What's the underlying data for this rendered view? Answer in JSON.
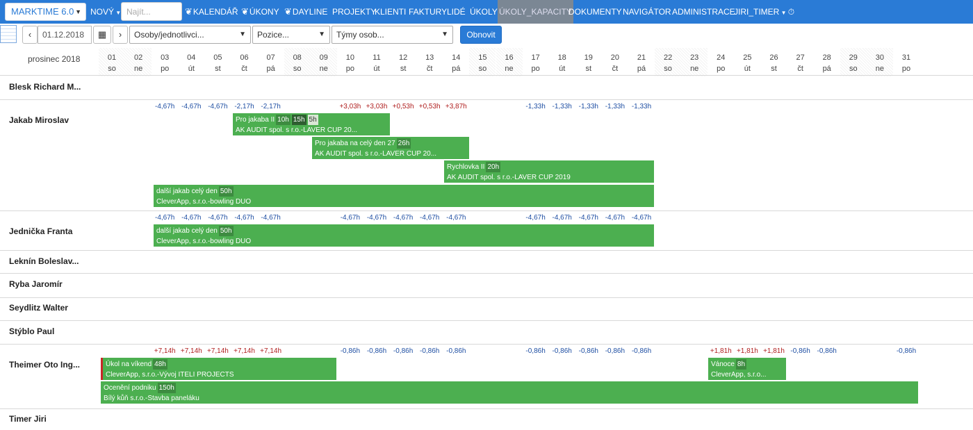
{
  "nav": {
    "brand": "MARKTIME 6.0",
    "new_label": "NOVÝ",
    "search_placeholder": "Najít...",
    "items": [
      "KALENDÁŘ",
      "ÚKONY",
      "DAYLINE",
      "PROJEKTY",
      "KLIENTI",
      "FAKTURY",
      "LIDÉ",
      "ÚKOLY",
      "ÚKOLY_KAPACITY",
      "DOKUMENTY",
      "NAVIGÁTOR",
      "ADMINISTRACE",
      "JIRI_TIMER"
    ],
    "active": "ÚKOLY_KAPACITY"
  },
  "toolbar": {
    "prev": "‹",
    "date": "01.12.2018",
    "next": "›",
    "people_select": "Osoby/jednotlivci...",
    "position_select": "Pozice...",
    "teams_select": "Týmy osob...",
    "refresh": "Obnovit"
  },
  "calendar": {
    "month": "prosinec 2018",
    "days": [
      {
        "d": "01",
        "w": "so"
      },
      {
        "d": "02",
        "w": "ne"
      },
      {
        "d": "03",
        "w": "po"
      },
      {
        "d": "04",
        "w": "út"
      },
      {
        "d": "05",
        "w": "st"
      },
      {
        "d": "06",
        "w": "čt"
      },
      {
        "d": "07",
        "w": "pá"
      },
      {
        "d": "08",
        "w": "so"
      },
      {
        "d": "09",
        "w": "ne"
      },
      {
        "d": "10",
        "w": "po"
      },
      {
        "d": "11",
        "w": "út"
      },
      {
        "d": "12",
        "w": "st"
      },
      {
        "d": "13",
        "w": "čt"
      },
      {
        "d": "14",
        "w": "pá"
      },
      {
        "d": "15",
        "w": "so"
      },
      {
        "d": "16",
        "w": "ne"
      },
      {
        "d": "17",
        "w": "po"
      },
      {
        "d": "18",
        "w": "út"
      },
      {
        "d": "19",
        "w": "st"
      },
      {
        "d": "20",
        "w": "čt"
      },
      {
        "d": "21",
        "w": "pá"
      },
      {
        "d": "22",
        "w": "so"
      },
      {
        "d": "23",
        "w": "ne"
      },
      {
        "d": "24",
        "w": "po"
      },
      {
        "d": "25",
        "w": "út"
      },
      {
        "d": "26",
        "w": "st"
      },
      {
        "d": "27",
        "w": "čt"
      },
      {
        "d": "28",
        "w": "pá"
      },
      {
        "d": "29",
        "w": "so"
      },
      {
        "d": "30",
        "w": "ne"
      },
      {
        "d": "31",
        "w": "po"
      }
    ]
  },
  "people": [
    {
      "name": "Blesk Richard M...",
      "hours": [],
      "tasks": []
    },
    {
      "name": "Jakab Miroslav",
      "hours": [
        [
          "03",
          "-4,67h"
        ],
        [
          "04",
          "-4,67h"
        ],
        [
          "05",
          "-4,67h"
        ],
        [
          "06",
          "-2,17h"
        ],
        [
          "07",
          "-2,17h"
        ],
        [
          "10",
          "+3,03h"
        ],
        [
          "11",
          "+3,03h"
        ],
        [
          "12",
          "+0,53h"
        ],
        [
          "13",
          "+0,53h"
        ],
        [
          "14",
          "+3,87h"
        ],
        [
          "17",
          "-1,33h"
        ],
        [
          "18",
          "-1,33h"
        ],
        [
          "19",
          "-1,33h"
        ],
        [
          "20",
          "-1,33h"
        ],
        [
          "21",
          "-1,33h"
        ]
      ],
      "tasks": [
        {
          "title": "Pro jakaba II",
          "badges": [
            "10h",
            "15h",
            "5h"
          ],
          "sub": "AK AUDIT spol. s r.o.-LAVER CUP 20..."
        },
        {
          "title": "Pro jakaba na celý den 27",
          "badges": [
            "26h"
          ],
          "sub": "AK AUDIT spol. s r.o.-LAVER CUP 20..."
        },
        {
          "title": "Rychlovka II",
          "badges": [
            "20h"
          ],
          "sub": "AK AUDIT spol. s r.o.-LAVER CUP 2019"
        },
        {
          "title": "další jakab celý den",
          "badges": [
            "50h"
          ],
          "sub": "CleverApp, s.r.o.-bowling DUO"
        }
      ]
    },
    {
      "name": "Jednička Franta",
      "hours": [
        [
          "03",
          "-4,67h"
        ],
        [
          "04",
          "-4,67h"
        ],
        [
          "05",
          "-4,67h"
        ],
        [
          "06",
          "-4,67h"
        ],
        [
          "07",
          "-4,67h"
        ],
        [
          "10",
          "-4,67h"
        ],
        [
          "11",
          "-4,67h"
        ],
        [
          "12",
          "-4,67h"
        ],
        [
          "13",
          "-4,67h"
        ],
        [
          "14",
          "-4,67h"
        ],
        [
          "17",
          "-4,67h"
        ],
        [
          "18",
          "-4,67h"
        ],
        [
          "19",
          "-4,67h"
        ],
        [
          "20",
          "-4,67h"
        ],
        [
          "21",
          "-4,67h"
        ]
      ],
      "tasks": [
        {
          "title": "další jakab celý den",
          "badges": [
            "50h"
          ],
          "sub": "CleverApp, s.r.o.-bowling DUO"
        }
      ]
    },
    {
      "name": "Leknín Boleslav...",
      "hours": [],
      "tasks": []
    },
    {
      "name": "Ryba Jaromír",
      "hours": [],
      "tasks": []
    },
    {
      "name": "Seydlitz Walter",
      "hours": [],
      "tasks": []
    },
    {
      "name": "Stýblo Paul",
      "hours": [],
      "tasks": []
    },
    {
      "name": "Theimer Oto Ing...",
      "hours": [
        [
          "03",
          "+7,14h"
        ],
        [
          "04",
          "+7,14h"
        ],
        [
          "05",
          "+7,14h"
        ],
        [
          "06",
          "+7,14h"
        ],
        [
          "07",
          "+7,14h"
        ],
        [
          "10",
          "-0,86h"
        ],
        [
          "11",
          "-0,86h"
        ],
        [
          "12",
          "-0,86h"
        ],
        [
          "13",
          "-0,86h"
        ],
        [
          "14",
          "-0,86h"
        ],
        [
          "17",
          "-0,86h"
        ],
        [
          "18",
          "-0,86h"
        ],
        [
          "19",
          "-0,86h"
        ],
        [
          "20",
          "-0,86h"
        ],
        [
          "21",
          "-0,86h"
        ],
        [
          "24",
          "+1,81h"
        ],
        [
          "25",
          "+1,81h"
        ],
        [
          "26",
          "+1,81h"
        ],
        [
          "27",
          "-0,86h"
        ],
        [
          "28",
          "-0,86h"
        ],
        [
          "31",
          "-0,86h"
        ]
      ],
      "tasks": [
        {
          "title": "Úkol na víkend",
          "badges": [
            "48h"
          ],
          "sub": "CleverApp, s.r.o.-Vývoj ITELI PROJECTS"
        },
        {
          "title": "Vánoce",
          "badges": [
            "8h"
          ],
          "sub": "CleverApp, s.r.o..."
        },
        {
          "title": "Ocenění podniku",
          "badges": [
            "150h"
          ],
          "sub": "Bílý kůň s.r.o.-Stavba paneláku"
        }
      ]
    },
    {
      "name": "Timer Jiri",
      "hours": [],
      "tasks": []
    }
  ]
}
